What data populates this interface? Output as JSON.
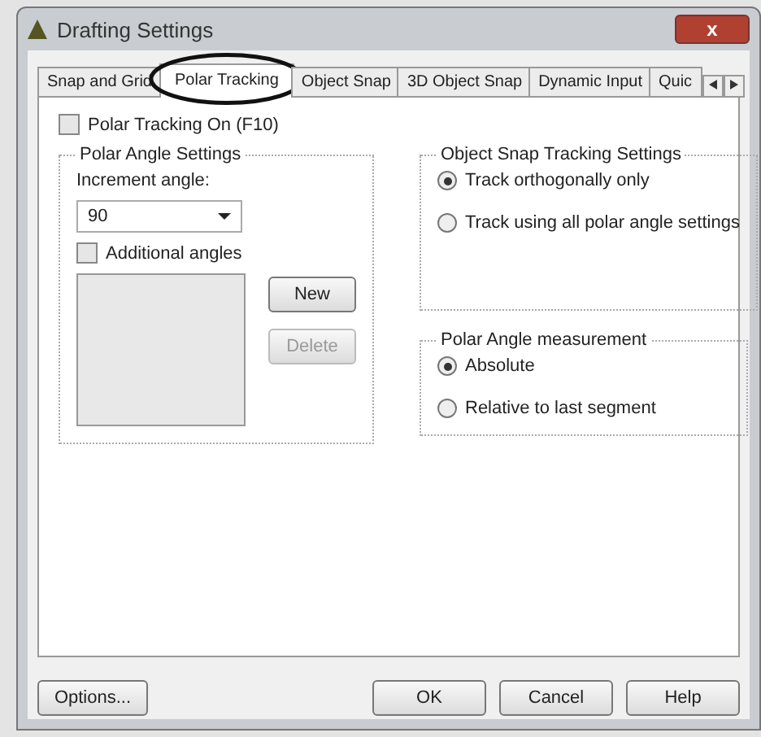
{
  "window": {
    "title": "Drafting Settings",
    "close": "x"
  },
  "tabs": [
    {
      "label": "Snap and Grid",
      "selected": false
    },
    {
      "label": "Polar Tracking",
      "selected": true
    },
    {
      "label": "Object Snap",
      "selected": false
    },
    {
      "label": "3D Object Snap",
      "selected": false
    },
    {
      "label": "Dynamic Input",
      "selected": false
    },
    {
      "label": "Quic",
      "selected": false
    }
  ],
  "polar_tracking_on": {
    "label": "Polar Tracking On (F10)",
    "checked": false
  },
  "polar_angle_settings": {
    "title": "Polar Angle Settings",
    "increment_label": "Increment angle:",
    "increment_value": "90",
    "additional_angles": {
      "label": "Additional angles",
      "checked": false
    },
    "buttons": [
      {
        "label": "New",
        "disabled": false
      },
      {
        "label": "Delete",
        "disabled": true
      }
    ]
  },
  "object_snap_tracking": {
    "title": "Object Snap Tracking Settings",
    "options": [
      {
        "label": "Track orthogonally only",
        "selected": true
      },
      {
        "label": "Track using all polar angle settings",
        "selected": false
      }
    ]
  },
  "polar_angle_measurement": {
    "title": "Polar Angle measurement",
    "options": [
      {
        "label": "Absolute",
        "selected": true
      },
      {
        "label": "Relative to last segment",
        "selected": false
      }
    ]
  },
  "footer": {
    "options": "Options...",
    "buttons": [
      "OK",
      "Cancel",
      "Help"
    ]
  }
}
